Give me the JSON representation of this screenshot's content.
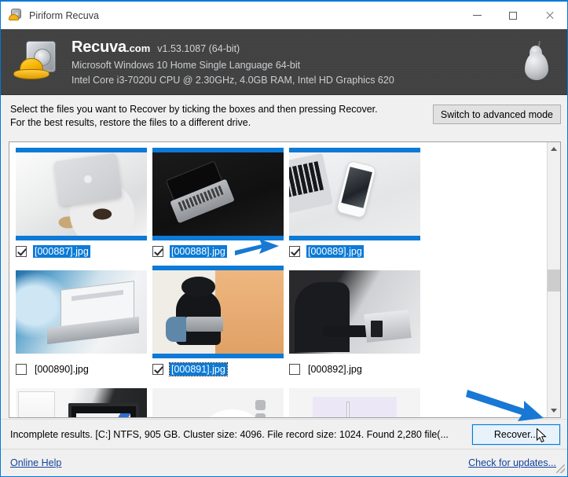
{
  "window": {
    "title": "Piriform Recuva",
    "app_icon": "recuva-disk-hardhat-icon",
    "controls": {
      "minimize": "minimize-icon",
      "maximize": "maximize-icon",
      "close": "close-icon"
    }
  },
  "header": {
    "brand_name": "Recuva",
    "brand_tld": ".com",
    "version": "v1.53.1087 (64-bit)",
    "os_line": "Microsoft Windows 10 Home Single Language 64-bit",
    "cpu_line": "Intel Core i3-7020U CPU @ 2.30GHz, 4.0GB RAM, Intel HD Graphics 620",
    "logo": "piriform-pear-logo"
  },
  "instructions": {
    "line1": "Select the files you want to Recover by ticking the boxes and then pressing Recover.",
    "line2": "For the best results, restore the files to a different drive.",
    "advanced_button": "Switch to advanced mode"
  },
  "filelist": {
    "files": [
      {
        "name": "[000887].jpg",
        "checked": true,
        "selected": true,
        "focused": false,
        "art": "img-887",
        "highlight": true
      },
      {
        "name": "[000888].jpg",
        "checked": true,
        "selected": true,
        "focused": false,
        "art": "img-888",
        "highlight": true
      },
      {
        "name": "[000889].jpg",
        "checked": true,
        "selected": true,
        "focused": false,
        "art": "img-889",
        "highlight": true
      },
      {
        "name": "[000890].jpg",
        "checked": false,
        "selected": false,
        "focused": false,
        "art": "img-890",
        "highlight": false
      },
      {
        "name": "[000891].jpg",
        "checked": true,
        "selected": true,
        "focused": true,
        "art": "img-891",
        "highlight": true
      },
      {
        "name": "[000892].jpg",
        "checked": false,
        "selected": false,
        "focused": false,
        "art": "img-892",
        "highlight": false
      },
      {
        "name": "",
        "checked": false,
        "selected": false,
        "focused": false,
        "art": "img-893",
        "highlight": false
      },
      {
        "name": "",
        "checked": false,
        "selected": false,
        "focused": false,
        "art": "img-894",
        "highlight": false
      },
      {
        "name": "",
        "checked": false,
        "selected": false,
        "focused": false,
        "art": "img-895",
        "highlight": false
      }
    ],
    "scrollbar": {
      "up_arrow": "chevron-up-icon",
      "down_arrow": "chevron-down-icon"
    }
  },
  "status": {
    "text": "Incomplete results. [C:] NTFS, 905 GB. Cluster size: 4096. File record size: 1024. Found 2,280 file(...",
    "recover_button": "Recover..."
  },
  "footer": {
    "online_help": "Online Help",
    "check_updates": "Check for updates..."
  },
  "annotations": {
    "arrow_color": "#1878d4",
    "arrow1": "blue-arrow-pointing-to-third-file",
    "arrow2": "blue-arrow-pointing-to-recover-button"
  },
  "colors": {
    "accent": "#0078d7",
    "selection": "#0c7ad6",
    "header_bg": "#414141",
    "link": "#11439b"
  }
}
